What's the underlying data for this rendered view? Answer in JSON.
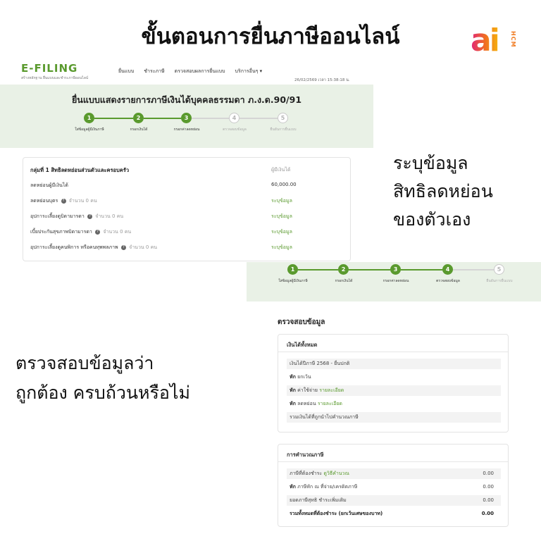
{
  "headline": "ขั้นตอนการยื่นภาษีออนไลน์",
  "logo": {
    "main": "ai",
    "sub": "HCM"
  },
  "header": {
    "brand": "E-FILING",
    "tagline": "สร้างหลักฐาน ยื่นแบบและชำระภาษีออนไลน์",
    "nav": [
      "ยื่นแบบ",
      "ชำระภาษี",
      "ตรวจสอบผลการยื่นแบบ",
      "บริการอื่นๆ ▾"
    ],
    "datetime": "26/02/2569 เวลา 15:38:18 น."
  },
  "form_title": "ยื่นแบบแสดงรายการภาษีเงินได้บุคคลธรรมดา ภ.ง.ด.90/91",
  "steps": [
    {
      "num": "1",
      "label": "ใส่ข้อมูลผู้มีเงินภาษี"
    },
    {
      "num": "2",
      "label": "กรอกเงินได้"
    },
    {
      "num": "3",
      "label": "กรอกค่าลดหย่อน"
    },
    {
      "num": "4",
      "label": "ตรวจสอบข้อมูล"
    },
    {
      "num": "5",
      "label": "ยืนยันการยื่นแบบ"
    }
  ],
  "deductions": {
    "group_title": "กลุ่มที่ 1 สิทธิลดหย่อนส่วนตัวและครอบครัว",
    "col_header": "ผู้มีเงินได้",
    "rows": [
      {
        "label": "ลดหย่อนผู้มีเงินได้",
        "note": "",
        "value": "60,000.00"
      },
      {
        "label": "ลดหย่อนบุตร",
        "note": "จำนวน 0 คน",
        "value": "ระบุข้อมูล"
      },
      {
        "label": "อุปการะเลี้ยงดูบิดามารดา",
        "note": "จำนวน 0 คน",
        "value": "ระบุข้อมูล"
      },
      {
        "label": "เบี้ยประกันสุขภาพบิดามารดา",
        "note": "จำนวน 0 คน",
        "value": "ระบุข้อมูล"
      },
      {
        "label": "อุปการะเลี้ยงดูคนพิการ หรือคนทุพพลภาพ",
        "note": "จำนวน 0 คน",
        "value": "ระบุข้อมูล"
      }
    ],
    "help_icon": "?"
  },
  "side_text_1": [
    "ระบุข้อมูล",
    "สิทธิลดหย่อน",
    "ของตัวเอง"
  ],
  "side_text_2": [
    "ตรวจสอบข้อมูลว่า",
    "ถูกต้อง ครบถ้วนหรือไม่"
  ],
  "verify": {
    "title": "ตรวจสอบข้อมูล",
    "income": {
      "header": "เงินได้ทั้งหมด",
      "row1": "เงินได้ปีภาษี 2568 - ยื่นปกติ",
      "row2_prefix": "หัก",
      "row2": "ยกเว้น",
      "row3_prefix": "หัก",
      "row3": "ค่าใช้จ่าย",
      "row3_link": "รายละเอียด",
      "row4_prefix": "หัก",
      "row4": "ลดหย่อน",
      "row4_link": "รายละเอียด",
      "row5": "รวมเงินได้ที่ถูกนำไปคำนวณภาษี"
    },
    "tax": {
      "header": "การคำนวณภาษี",
      "row1": "ภาษีที่ต้องชำระ",
      "row1_link": "ดูวิธีคำนวณ",
      "row1_value": "0.00",
      "row2_prefix": "หัก",
      "row2": "ภาษีหัก ณ ที่จ่าย/เครดิตภาษี",
      "row2_value": "0.00",
      "row3": "ยอดภาษีสุทธิ ชำระเพิ่มเติม",
      "row3_value": "0.00",
      "row4": "รวมทั้งหมดที่ต้องชำระ (ยกเว้นเศษของบาท)",
      "row4_value": "0.00"
    }
  },
  "colors": {
    "accent_green": "#5a9a2e",
    "panel_bg": "#e9f1e6"
  }
}
